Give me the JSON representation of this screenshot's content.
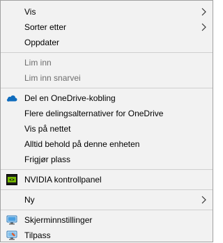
{
  "menu": {
    "view": "Vis",
    "sort_by": "Sorter etter",
    "refresh": "Oppdater",
    "paste": "Lim inn",
    "paste_shortcut": "Lim inn snarvei",
    "share_onedrive_link": "Del en OneDrive-kobling",
    "more_sharing_options": "Flere delingsalternativer for OneDrive",
    "view_online": "Vis på nettet",
    "always_keep_on_device": "Alltid behold på denne enheten",
    "free_up_space": "Frigjør plass",
    "nvidia_control_panel": "NVIDIA kontrollpanel",
    "new": "Ny",
    "display_settings": "Skjerminnstillinger",
    "personalize": "Tilpass"
  },
  "icons": {
    "onedrive": "onedrive-cloud-icon",
    "nvidia": "nvidia-icon",
    "display": "display-icon",
    "personalize": "personalize-icon",
    "submenu": "chevron-right-icon"
  },
  "colors": {
    "menu_background": "#f2f2f2",
    "disabled_text": "#6d6d6d",
    "separator": "#cfcfcf",
    "onedrive_blue": "#0f6cbd",
    "nvidia_green": "#76b900"
  }
}
